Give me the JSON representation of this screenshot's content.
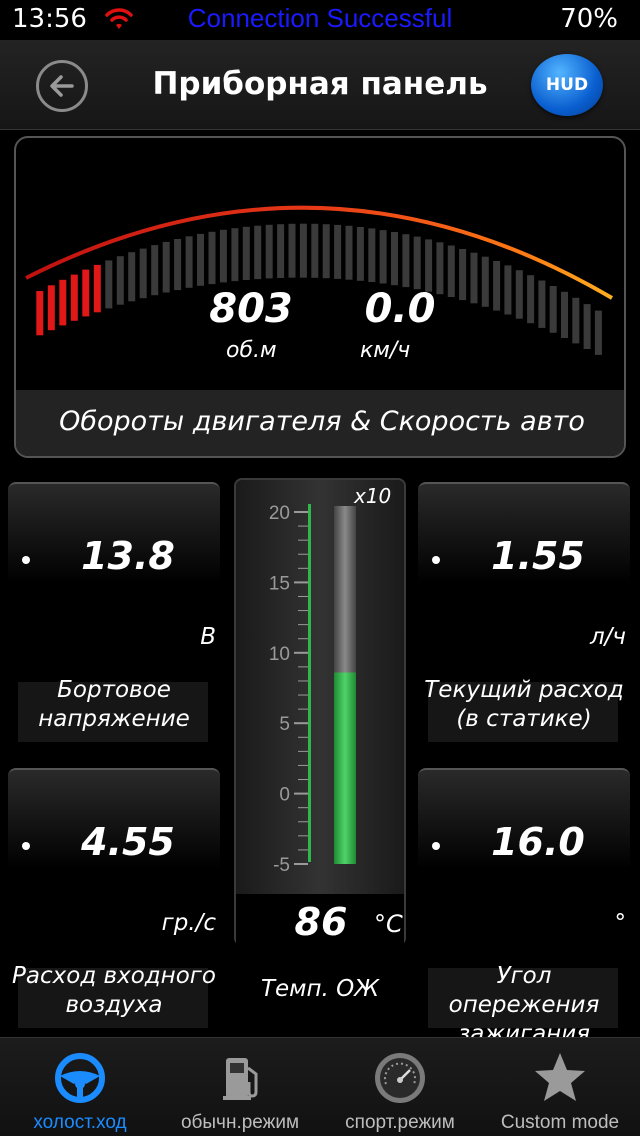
{
  "status_bar": {
    "time": "13:56",
    "message": "Connection Successful",
    "battery": "70%"
  },
  "header": {
    "title": "Приборная панель",
    "hud_label": "HUD"
  },
  "main_gauge": {
    "rpm_value": "803",
    "rpm_unit": "об.м",
    "speed_value": "0.0",
    "speed_unit": "км/ч",
    "caption": "Обороты двигателя & Скорость авто"
  },
  "tiles": {
    "voltage": {
      "value": "13.8",
      "unit": "В",
      "caption_line1": "Бортовое",
      "caption_line2": "напряжение"
    },
    "fuel": {
      "value": "1.55",
      "unit": "л/ч",
      "caption_line1": "Текущий расход",
      "caption_line2": "(в статике)"
    },
    "airflow": {
      "value": "4.55",
      "unit": "гр./с",
      "caption_line1": "Расход входного",
      "caption_line2": "воздуха"
    },
    "ignition": {
      "value": "16.0",
      "unit": "°",
      "caption_line1": "Угол опережения",
      "caption_line2": "зажигания"
    }
  },
  "thermometer": {
    "multiplier": "x10",
    "scale_labels": [
      "20",
      "15",
      "10",
      "5",
      "0",
      "-5"
    ],
    "value": "86",
    "unit": "°C",
    "caption": "Темп. ОЖ"
  },
  "tabs": [
    {
      "label": "холост.ход",
      "icon": "steering-wheel-icon",
      "active": true
    },
    {
      "label": "обычн.режим",
      "icon": "fuel-pump-icon",
      "active": false
    },
    {
      "label": "спорт.режим",
      "icon": "speedometer-icon",
      "active": false
    },
    {
      "label": "Custom mode",
      "icon": "star-icon",
      "active": false
    }
  ],
  "colors": {
    "accent": "#1b8cff",
    "status_message": "#1a1aff",
    "wifi": "#e01010",
    "gauge_red": "#e01818",
    "gauge_orange": "#ff9a1a",
    "thermo_green": "#2fb84a"
  }
}
